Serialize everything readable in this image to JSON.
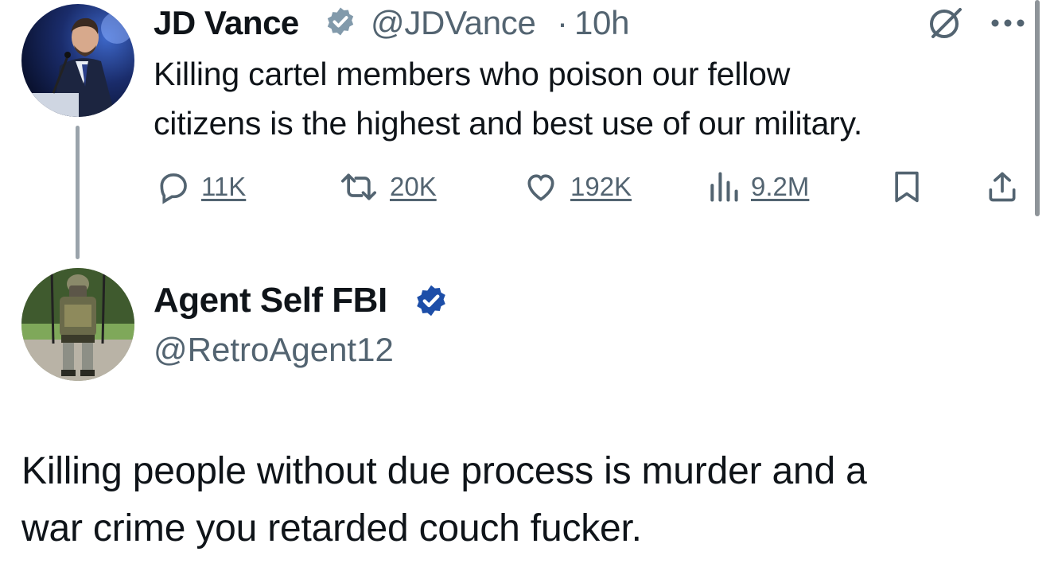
{
  "parent_tweet": {
    "author_name": "JD Vance",
    "handle": "@JDVance",
    "separator": "·",
    "time": "10h",
    "text_line1": "Killing cartel members who poison our fellow",
    "text_line2": "citizens is the highest and best use of our military.",
    "replies": "11K",
    "reposts": "20K",
    "likes": "192K",
    "views": "9.2M",
    "more_label": "···"
  },
  "reply_tweet": {
    "author_name": "Agent Self FBI",
    "handle": "@RetroAgent12",
    "text_line1": "Killing people without due process is murder and a",
    "text_line2": "war crime you retarded couch fucker."
  },
  "colors": {
    "text": "#0f1419",
    "secondary": "#536471",
    "verified_gray": "#829aab",
    "verified_blue": "#1d4ea8"
  }
}
